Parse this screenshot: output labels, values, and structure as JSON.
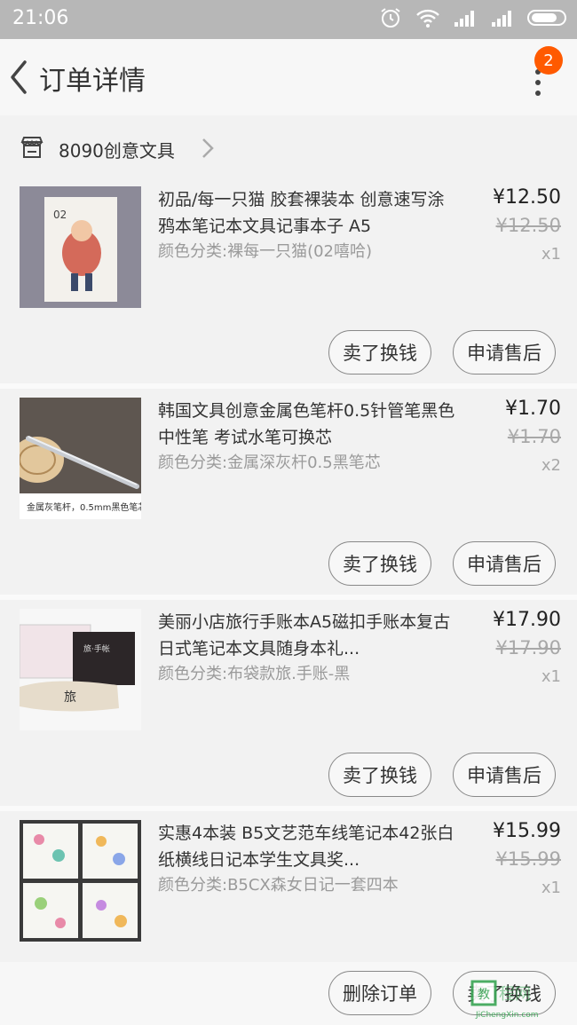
{
  "status": {
    "time": "21:06"
  },
  "header": {
    "title": "订单详情",
    "badge": "2"
  },
  "shop": {
    "name": "8090创意文具"
  },
  "items": [
    {
      "name": "初品/每一只猫 胶套裸装本 创意速写涂鸦本笔记本文具记事本子 A5",
      "spec": "颜色分类:裸每一只猫(02嘻哈)",
      "price": "¥12.50",
      "orig": "¥12.50",
      "qty": "x1",
      "btn1": "卖了换钱",
      "btn2": "申请售后"
    },
    {
      "name": "韩国文具创意金属色笔杆0.5针管笔黑色中性笔 考试水笔可换芯",
      "spec": "颜色分类:金属深灰杆0.5黑笔芯",
      "price": "¥1.70",
      "orig": "¥1.70",
      "qty": "x2",
      "btn1": "卖了换钱",
      "btn2": "申请售后"
    },
    {
      "name": "美丽小店旅行手账本A5磁扣手账本复古日式笔记本文具随身本礼...",
      "spec": "颜色分类:布袋款旅.手账-黑",
      "price": "¥17.90",
      "orig": "¥17.90",
      "qty": "x1",
      "btn1": "卖了换钱",
      "btn2": "申请售后"
    },
    {
      "name": "实惠4本装 B5文艺范车线笔记本42张白纸横线日记本学生文具奖...",
      "spec": "颜色分类:B5CX森女日记一套四本",
      "price": "¥15.99",
      "orig": "¥15.99",
      "qty": "x1"
    }
  ],
  "footer": {
    "delete_label": "删除订单",
    "sell_label": "卖了换钱"
  },
  "watermark": {
    "text": "JiChengXin.com"
  }
}
